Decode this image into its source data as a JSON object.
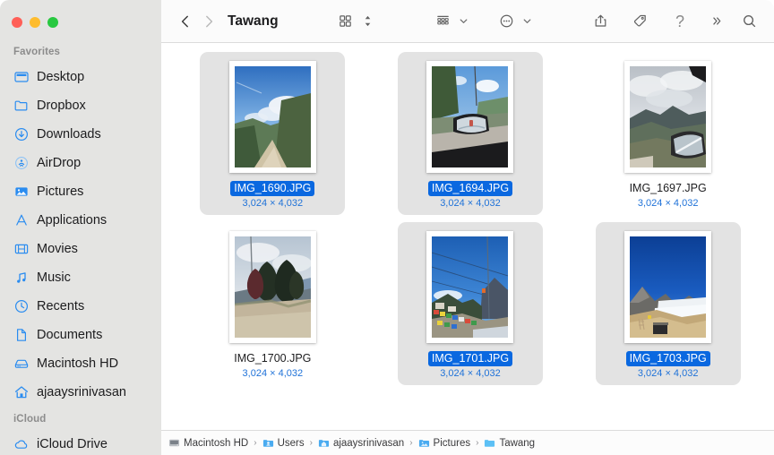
{
  "window": {
    "title": "Tawang",
    "traffic_lights": [
      "close",
      "minimize",
      "maximize"
    ],
    "accent_color": "#0a68e0",
    "sidebar_bg": "#e4e4e2",
    "selected_tile_bg": "#e3e3e3",
    "size_text_color": "#1f72d8"
  },
  "sidebar": {
    "sections": [
      {
        "title": "Favorites",
        "items": [
          {
            "label": "Desktop",
            "icon": "desktop-icon"
          },
          {
            "label": "Dropbox",
            "icon": "folder-icon"
          },
          {
            "label": "Downloads",
            "icon": "download-circle-icon"
          },
          {
            "label": "AirDrop",
            "icon": "airdrop-icon"
          },
          {
            "label": "Pictures",
            "icon": "pictures-icon"
          },
          {
            "label": "Applications",
            "icon": "applications-icon"
          },
          {
            "label": "Movies",
            "icon": "movies-icon"
          },
          {
            "label": "Music",
            "icon": "music-note-icon"
          },
          {
            "label": "Recents",
            "icon": "clock-icon"
          },
          {
            "label": "Documents",
            "icon": "document-icon"
          },
          {
            "label": "Macintosh HD",
            "icon": "hard-drive-icon"
          },
          {
            "label": "ajaaysrinivasan",
            "icon": "home-icon"
          }
        ]
      },
      {
        "title": "iCloud",
        "items": [
          {
            "label": "iCloud Drive",
            "icon": "cloud-icon"
          }
        ]
      }
    ]
  },
  "toolbar": {
    "back_label": "‹",
    "forward_label": "›",
    "title": "Tawang",
    "buttons": [
      {
        "name": "view-icon-grid",
        "icon": "grid-view-icon"
      },
      {
        "name": "sort-stepper",
        "icon": "sort-chevrons-icon"
      },
      {
        "name": "group-by",
        "icon": "group-list-icon"
      },
      {
        "name": "group-by-chevron",
        "icon": "chevron-down-icon"
      },
      {
        "name": "more-actions",
        "icon": "ellipsis-circle-icon"
      },
      {
        "name": "more-chevron",
        "icon": "chevron-down-icon"
      },
      {
        "name": "share",
        "icon": "share-icon"
      },
      {
        "name": "tags",
        "icon": "tag-icon"
      },
      {
        "name": "help",
        "icon": "question-mark-icon"
      },
      {
        "name": "overflow",
        "icon": "double-chevron-right-icon"
      },
      {
        "name": "search",
        "icon": "search-icon"
      }
    ]
  },
  "files": [
    {
      "name": "IMG_1690.JPG",
      "size": "3,024 × 4,032",
      "selected": true,
      "thumb": "road-blue-sky"
    },
    {
      "name": "IMG_1694.JPG",
      "size": "3,024 × 4,032",
      "selected": true,
      "thumb": "car-mirror-road"
    },
    {
      "name": "IMG_1697.JPG",
      "size": "3,024 × 4,032",
      "selected": false,
      "thumb": "cloudy-mountain-mirror"
    },
    {
      "name": "IMG_1700.JPG",
      "size": "3,024 × 4,032",
      "selected": false,
      "thumb": "pine-trees-dirt"
    },
    {
      "name": "IMG_1701.JPG",
      "size": "3,024 × 4,032",
      "selected": true,
      "thumb": "prayer-flags-valley"
    },
    {
      "name": "IMG_1703.JPG",
      "size": "3,024 × 4,032",
      "selected": true,
      "thumb": "deep-blue-sky-snow"
    }
  ],
  "pathbar": {
    "crumbs": [
      {
        "label": "Macintosh HD",
        "icon": "hard-drive-small-icon"
      },
      {
        "label": "Users",
        "icon": "folder-users-icon"
      },
      {
        "label": "ajaaysrinivasan",
        "icon": "folder-home-icon"
      },
      {
        "label": "Pictures",
        "icon": "folder-pictures-icon"
      },
      {
        "label": "Tawang",
        "icon": "folder-icon"
      }
    ],
    "separator": "›"
  }
}
